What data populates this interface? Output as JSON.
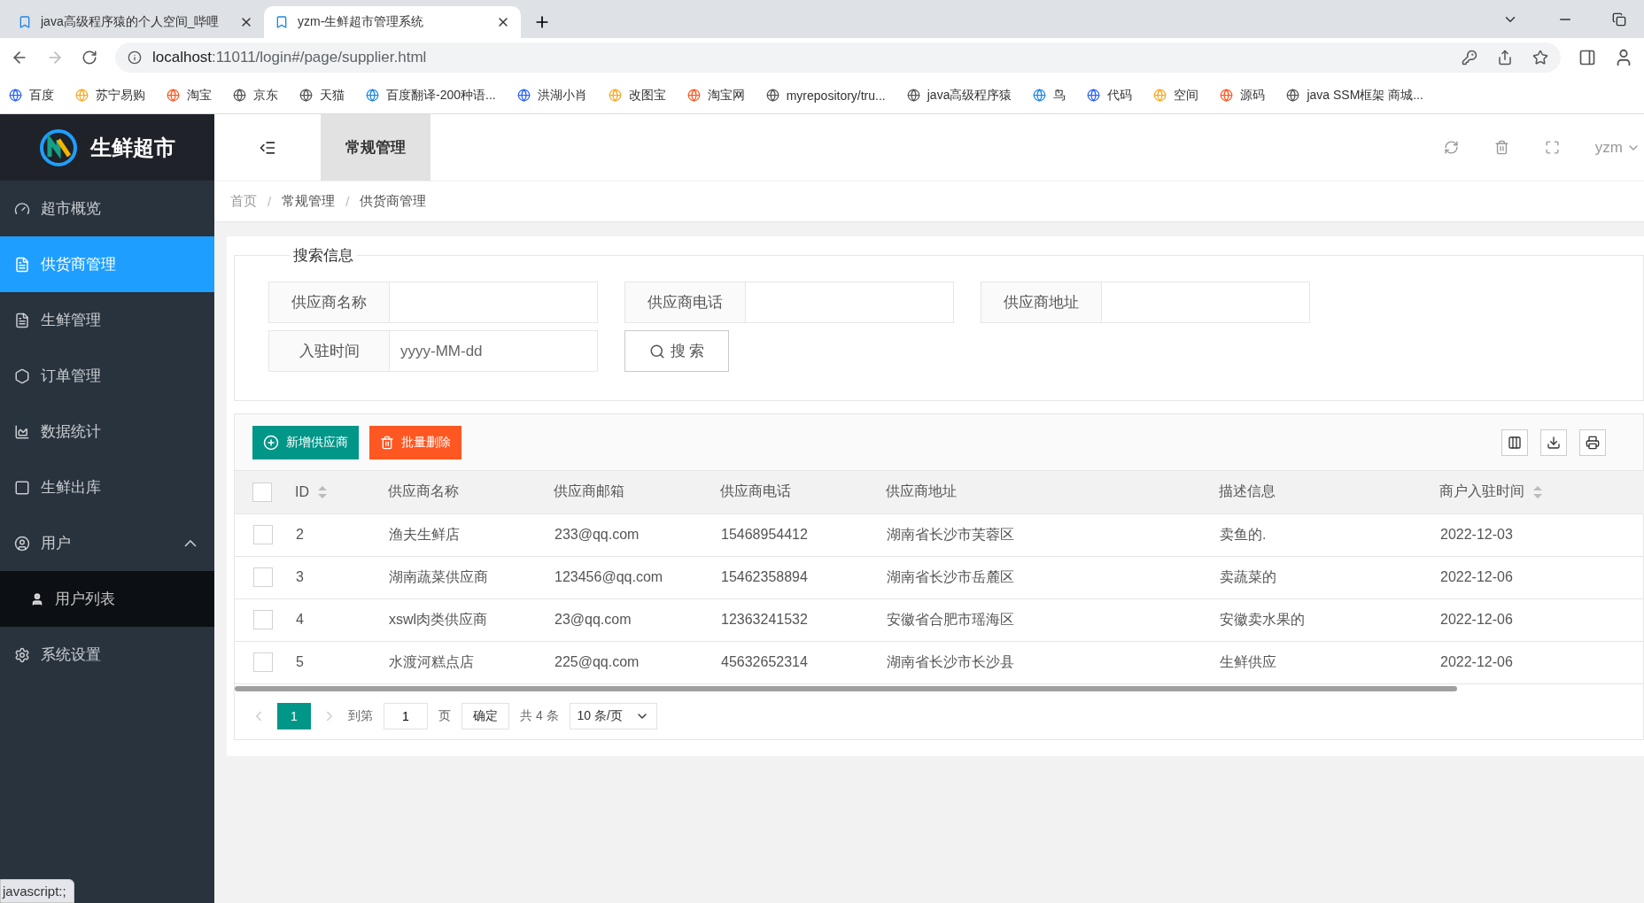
{
  "browser": {
    "tabs": [
      {
        "title": "java高级程序猿的个人空间_哔哩",
        "selected": false
      },
      {
        "title": "yzm-生鲜超市管理系统",
        "selected": true
      }
    ],
    "url_host": "localhost",
    "url_rest": ":11011/login#/page/supplier.html",
    "bookmarks": [
      "百度",
      "苏宁易购",
      "淘宝",
      "京东",
      "天猫",
      "百度翻译-200种语...",
      "洪湖小肖",
      "改图宝",
      "淘宝网",
      "myrepository/tru...",
      "java高级程序猿",
      "鸟",
      "代码",
      "空间",
      "源码",
      "java SSM框架 商城..."
    ]
  },
  "sidebar": {
    "logo": "生鲜超市",
    "items": [
      {
        "label": "超市概览",
        "selected": false
      },
      {
        "label": "供货商管理",
        "selected": true
      },
      {
        "label": "生鲜管理",
        "selected": false
      },
      {
        "label": "订单管理",
        "selected": false
      },
      {
        "label": "数据统计",
        "selected": false
      },
      {
        "label": "生鲜出库",
        "selected": false
      },
      {
        "label": "用户",
        "selected": false,
        "expanded": true,
        "children": [
          {
            "label": "用户列表",
            "selected": false
          }
        ]
      },
      {
        "label": "系统设置",
        "selected": false
      }
    ]
  },
  "header": {
    "tabs": [
      {
        "label": "常规管理",
        "selected": true
      }
    ],
    "user": "yzm"
  },
  "breadcrumb": [
    {
      "kind": "link",
      "label": "首页"
    },
    {
      "kind": "separator",
      "label": "/"
    },
    {
      "kind": "link",
      "label": "常规管理"
    },
    {
      "kind": "separator",
      "label": "/"
    },
    {
      "kind": "current",
      "label": "供货商管理"
    }
  ],
  "search": {
    "legend": "搜索信息",
    "fields": [
      {
        "label": "供应商名称"
      },
      {
        "label": "供应商电话"
      },
      {
        "label": "供应商地址"
      },
      {
        "label": "入驻时间",
        "placeholder": "yyyy-MM-dd"
      }
    ],
    "button": "搜 索"
  },
  "toolbar": {
    "buttons": [
      {
        "label": "新增供应商",
        "kind": "add"
      },
      {
        "label": "批量删除",
        "kind": "delete"
      }
    ]
  },
  "table": {
    "columns": [
      {
        "label": "ID",
        "sortable": true
      },
      {
        "label": "供应商名称",
        "sortable": false
      },
      {
        "label": "供应商邮箱",
        "sortable": false
      },
      {
        "label": "供应商电话",
        "sortable": false
      },
      {
        "label": "供应商地址",
        "sortable": false
      },
      {
        "label": "描述信息",
        "sortable": false
      },
      {
        "label": "商户入驻时间",
        "sortable": true
      }
    ],
    "header_checked": false,
    "rows": [
      {
        "checked": false,
        "cells": [
          "2",
          "渔夫生鲜店",
          "233@qq.com",
          "15468954412",
          "湖南省长沙市芙蓉区",
          "卖鱼的.",
          "2022-12-03"
        ]
      },
      {
        "checked": false,
        "cells": [
          "3",
          "湖南蔬菜供应商",
          "123456@qq.com",
          "15462358894",
          "湖南省长沙市岳麓区",
          "卖蔬菜的",
          "2022-12-06"
        ]
      },
      {
        "checked": false,
        "cells": [
          "4",
          "xswl肉类供应商",
          "23@qq.com",
          "12363241532",
          "安徽省合肥市瑶海区",
          "安徽卖水果的",
          "2022-12-06"
        ]
      },
      {
        "checked": false,
        "cells": [
          "5",
          "水渡河糕点店",
          "225@qq.com",
          "45632652314",
          "湖南省长沙市长沙县",
          "生鲜供应",
          "2022-12-06"
        ]
      }
    ]
  },
  "pagination": {
    "pages": [
      {
        "label": "1",
        "selected": true
      }
    ],
    "goto": "到第",
    "page_value": "1",
    "page_unit": "页",
    "confirm": "确定",
    "total": "共 4 条",
    "page_size": "10 条/页"
  },
  "status_link": "javascript:;"
}
